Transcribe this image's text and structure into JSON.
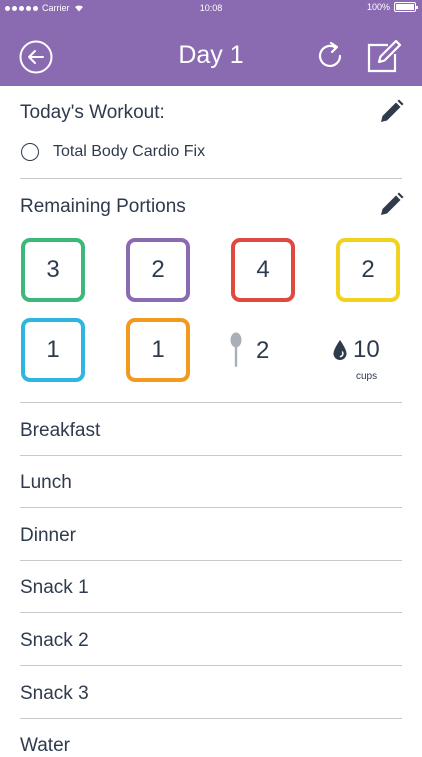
{
  "status_bar": {
    "carrier": "Carrier",
    "time": "10:08",
    "battery": "100%"
  },
  "nav": {
    "title": "Day 1"
  },
  "workout": {
    "heading": "Today's Workout:",
    "item": "Total Body Cardio Fix"
  },
  "portions": {
    "heading": "Remaining Portions",
    "containers": [
      {
        "color": "#3cb878",
        "count": "3"
      },
      {
        "color": "#8a6bb2",
        "count": "2"
      },
      {
        "color": "#de4a3f",
        "count": "4"
      },
      {
        "color": "#f2d21f",
        "count": "2"
      },
      {
        "color": "#2fb6e0",
        "count": "1"
      },
      {
        "color": "#f29a1e",
        "count": "1"
      }
    ],
    "teaspoons": "2",
    "water": {
      "count": "10",
      "unit": "cups"
    }
  },
  "meals": [
    "Breakfast",
    "Lunch",
    "Dinner",
    "Snack 1",
    "Snack 2",
    "Snack 3",
    "Water"
  ]
}
